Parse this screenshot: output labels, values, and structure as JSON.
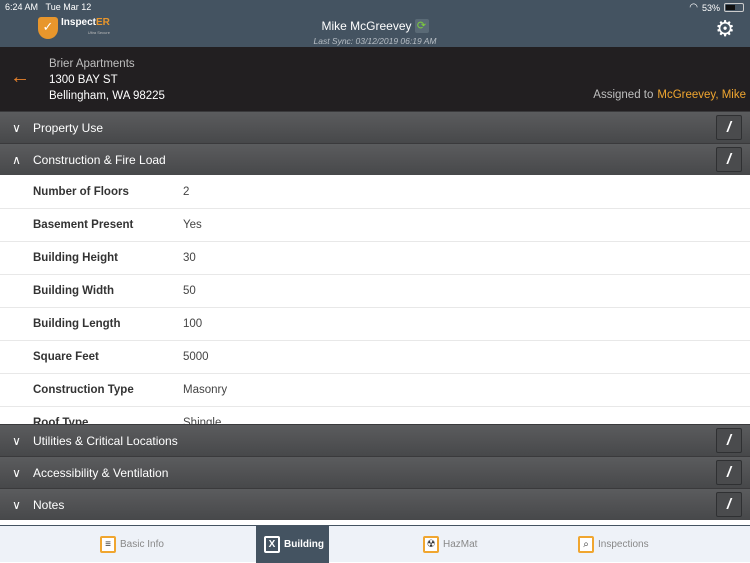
{
  "status_bar": {
    "time": "6:24 AM",
    "date": "Tue Mar 12",
    "battery": "53%"
  },
  "app": {
    "logo_main": "Inspect",
    "logo_accent": "ER",
    "logo_sub": "Ultra Secure",
    "user_name": "Mike McGreevey",
    "last_sync": "Last Sync: 03/12/2019 06:19 AM",
    "icons": {
      "sync": "sync-icon",
      "settings": "gear-icon"
    }
  },
  "property": {
    "name": "Brier Apartments",
    "street": "1300 BAY ST",
    "city": "Bellingham, WA 98225",
    "assigned_label": "Assigned to",
    "assigned_to": "McGreevey, Mike"
  },
  "sections": [
    {
      "label": "Property Use",
      "expanded": false
    },
    {
      "label": "Construction & Fire Load",
      "expanded": true
    },
    {
      "label": "Utilities & Critical Locations",
      "expanded": false
    },
    {
      "label": "Accessibility & Ventilation",
      "expanded": false
    },
    {
      "label": "Notes",
      "expanded": false
    }
  ],
  "construction_fields": [
    {
      "label": "Number of Floors",
      "value": "2"
    },
    {
      "label": "Basement Present",
      "value": "Yes"
    },
    {
      "label": "Building Height",
      "value": "30"
    },
    {
      "label": "Building Width",
      "value": "50"
    },
    {
      "label": "Building Length",
      "value": "100"
    },
    {
      "label": "Square Feet",
      "value": "5000"
    },
    {
      "label": "Construction Type",
      "value": "Masonry"
    },
    {
      "label": "Roof Type",
      "value": "Shingle"
    }
  ],
  "tabs": [
    {
      "label": "Basic Info",
      "active": false
    },
    {
      "label": "Building",
      "active": true
    },
    {
      "label": "HazMat",
      "active": false
    },
    {
      "label": "Inspections",
      "active": false
    }
  ],
  "colors": {
    "accent": "#f0a630",
    "topbar": "#445361",
    "header": "#221f21",
    "back_arrow": "#e8822c",
    "sync_green": "#7ccf3b"
  }
}
